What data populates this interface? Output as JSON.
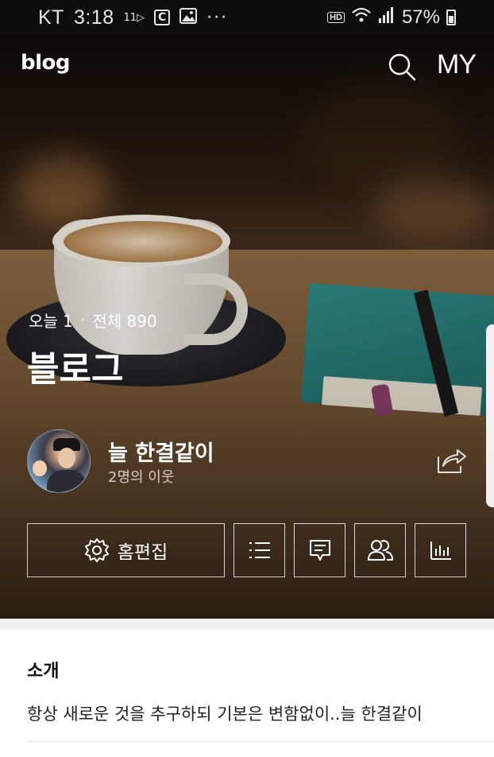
{
  "status_bar": {
    "carrier": "KT",
    "time": "3:18",
    "notif_11st": "11▷",
    "notif_c": "C",
    "more": "···",
    "hd": "HD",
    "battery": "57%"
  },
  "nav": {
    "logo": "blog",
    "my_label": "MY"
  },
  "hero": {
    "today_label": "오늘 1",
    "separator": "·",
    "total_label": "전체 890",
    "blog_title": "블로그"
  },
  "profile": {
    "name": "늘 한결같이",
    "neighbors": "2명의 이웃"
  },
  "actions": {
    "home_edit": "홈편집"
  },
  "intro": {
    "heading": "소개",
    "text": "항상 새로운 것을 추구하되 기본은 변함없이..늘 한결같이"
  },
  "icons": {
    "search": "search-icon",
    "share": "share-icon",
    "gear": "gear-icon",
    "list": "list-icon",
    "comment": "comment-icon",
    "neighbors": "people-icon",
    "stats": "bar-chart-icon"
  }
}
